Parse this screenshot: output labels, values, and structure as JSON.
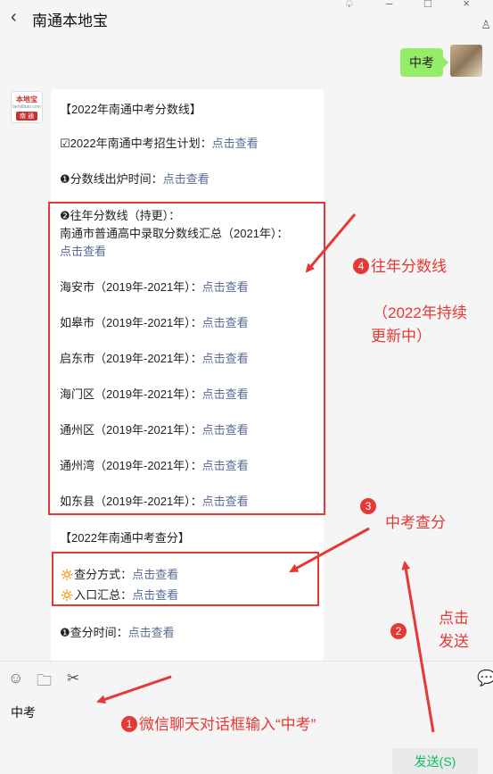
{
  "header": {
    "back": "‹",
    "title": "南通本地宝",
    "win_icons": "♤ – □ ×",
    "person": "♙"
  },
  "chat": {
    "outgoing": "中考",
    "bot_avatar": {
      "brand": "本地宝",
      "domain": "bendibao.com",
      "city": "南 通"
    },
    "card": {
      "title1": "【2022年南通中考分数线】",
      "plan_prefix": "☑2022年南通中考招生计划：",
      "time_prefix": "❶分数线出炉时间：",
      "past_title": "❷往年分数线（持更）：",
      "nantong_line": "南通市普通高中录取分数线汇总（2021年）：",
      "cities": [
        {
          "label": "海安市（2019年-2021年）："
        },
        {
          "label": "如皋市（2019年-2021年）："
        },
        {
          "label": "启东市（2019年-2021年）："
        },
        {
          "label": "海门区（2019年-2021年）："
        },
        {
          "label": "通州区（2019年-2021年）："
        },
        {
          "label": "通州湾（2019年-2021年）："
        },
        {
          "label": "如东县（2019年-2021年）："
        }
      ],
      "title2": "【2022年南通中考查分】",
      "method_prefix": "🔅查分方式：",
      "entry_prefix": "🔅入口汇总：",
      "score_time_prefix": "❶查分时间：",
      "link_text": "点击查看"
    }
  },
  "annotations": {
    "a4_num": "4",
    "a4_text": "往年分数线",
    "a4_note1": "（2022年持续",
    "a4_note2": "更新中）",
    "a3_num": "3",
    "a3_text": "中考查分",
    "a2_num": "2",
    "a2_text1": "点击",
    "a2_text2": "发送",
    "a1_num": "1",
    "a1_text": "微信聊天对话框输入“中考”"
  },
  "toolbar": {
    "emoji": "☺",
    "folder": "🗀",
    "scissors": "✂",
    "chat": "💬"
  },
  "input": {
    "value": "中考"
  },
  "send_label": "发送(S)",
  "colors": {
    "accent_red": "#e53935",
    "link": "#576b95",
    "bubble": "#95ec69",
    "send_text": "#07c160"
  }
}
